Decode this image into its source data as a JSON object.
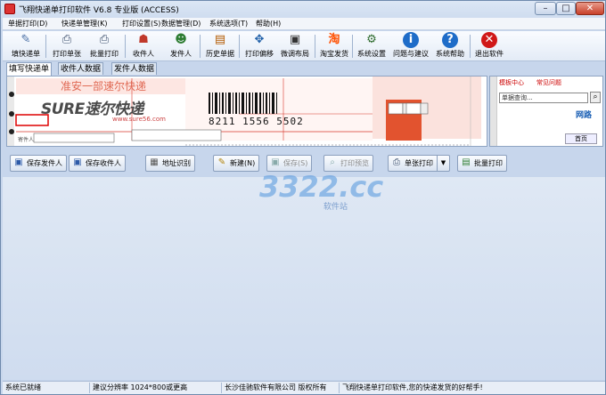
{
  "window": {
    "title": "飞翔快递单打印软件 V6.8 专业版 (ACCESS)",
    "controls": {
      "minimize": "–",
      "maximize": "□",
      "close": "✕"
    }
  },
  "menu": [
    {
      "label": "单据打印(D)"
    },
    {
      "label": "快递单管理(K)"
    },
    {
      "label": "打印设置(S)"
    },
    {
      "label": "数据管理(D)"
    },
    {
      "label": "系统选项(T)"
    },
    {
      "label": "帮助(H)"
    }
  ],
  "toolbar": [
    {
      "label": "填快递单",
      "icon": "pen-paper-icon"
    },
    {
      "label": "打印单张",
      "icon": "printer-icon"
    },
    {
      "label": "批量打印",
      "icon": "batch-printer-icon"
    },
    {
      "label": "收件人",
      "icon": "recipient-icon"
    },
    {
      "label": "发件人",
      "icon": "sender-icon"
    },
    {
      "label": "历史单据",
      "icon": "history-icon"
    },
    {
      "label": "打印偏移",
      "icon": "offset-icon"
    },
    {
      "label": "微调布局",
      "icon": "layout-icon"
    },
    {
      "label": "淘宝发货",
      "icon": "taobao-icon"
    },
    {
      "label": "系统设置",
      "icon": "settings-icon"
    },
    {
      "label": "问题与建议",
      "icon": "info-icon"
    },
    {
      "label": "系统帮助",
      "icon": "help-icon"
    },
    {
      "label": "退出软件",
      "icon": "exit-icon"
    }
  ],
  "tabs": [
    {
      "label": "填写快递单",
      "active": true
    },
    {
      "label": "收件人数据",
      "active": false
    },
    {
      "label": "发件人数据",
      "active": false
    }
  ],
  "waybill": {
    "top_text": "准安一部速尔快递",
    "logo": "SURE速尔快递",
    "site": "www.sure56.com",
    "barcode_number": "8211 1556 5502",
    "small_label": "寄件人"
  },
  "web": {
    "link1": "模板中心",
    "link2": "常见问题",
    "search_placeholder": "单据查询...",
    "side_text": "网路",
    "home_button": "首页"
  },
  "actions": [
    {
      "label": "保存发件人",
      "icon": "save-icon",
      "enabled": true
    },
    {
      "label": "保存收件人",
      "icon": "save-icon",
      "enabled": true
    },
    {
      "label": "地址识别",
      "icon": "address-icon",
      "enabled": true
    },
    {
      "label": "新建(N)",
      "icon": "new-icon",
      "enabled": true
    },
    {
      "label": "保存(S)",
      "icon": "save-icon",
      "enabled": false
    },
    {
      "label": "打印预览",
      "icon": "preview-icon",
      "enabled": false
    },
    {
      "label": "单张打印",
      "icon": "print-icon",
      "enabled": true
    },
    {
      "label": "批量打印",
      "icon": "batch-icon",
      "enabled": true
    }
  ],
  "watermark": {
    "text": "3322.cc",
    "sub": "软件站"
  },
  "status": [
    "系统已就绪",
    "建议分辨率 1024*800或更高",
    "长沙佳驰软件有限公司 版权所有",
    "飞翔快递单打印软件,您的快递发货的好帮手!"
  ],
  "colors": {
    "accent": "#3b6bb5",
    "waybill_red": "#d8382c",
    "surface": "#d6e2f1"
  }
}
